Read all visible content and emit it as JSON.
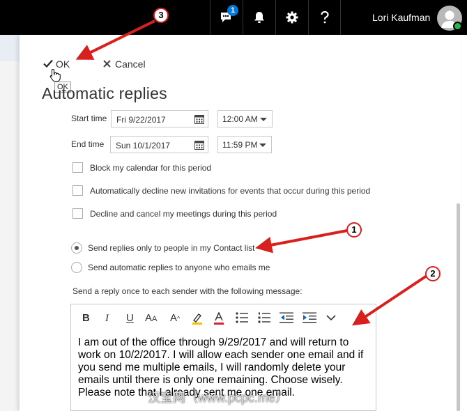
{
  "topbar": {
    "user_name": "Lori Kaufman",
    "chat_badge": "1",
    "icons": [
      "chat-icon",
      "bell-icon",
      "gear-icon",
      "help-icon",
      "avatar-icon"
    ],
    "background_color": "#000000"
  },
  "commands": {
    "ok_label": "OK",
    "cancel_label": "Cancel",
    "tooltip": "OK"
  },
  "page_title": "Automatic replies",
  "schedule": {
    "start_label": "Start time",
    "start_date": "Fri 9/22/2017",
    "start_time": "12:00 AM",
    "end_label": "End time",
    "end_date": "Sun 10/1/2017",
    "end_time": "11:59 PM"
  },
  "options": [
    {
      "label": "Block my calendar for this period",
      "checked": false
    },
    {
      "label": "Automatically decline new invitations for events that occur during this period",
      "checked": false
    },
    {
      "label": "Decline and cancel my meetings during this period",
      "checked": false
    }
  ],
  "audience": [
    {
      "label": "Send replies only to people in my Contact list",
      "selected": true
    },
    {
      "label": "Send automatic replies to anyone who emails me",
      "selected": false
    }
  ],
  "message": {
    "label": "Send a reply once to each sender with the following message:",
    "toolbar": {
      "bold": "B",
      "italic": "I",
      "underline": "U",
      "font_size": "A",
      "grow_font": "A"
    },
    "body": "I am out of the office through 9/29/2017 and will return to work on 10/2/2017. I will allow each sender one email and if you send me multiple emails, I will randomly delete your emails until there is only one remaining. Choose wisely. Please note that I already sent me one email."
  },
  "watermark": "汉宝网（www.pcpc.me）",
  "annotations": [
    {
      "number": "1"
    },
    {
      "number": "2"
    },
    {
      "number": "3"
    }
  ],
  "colors": {
    "annotation_red": "#d8201e",
    "status_green": "#2fb54a",
    "badge_blue": "#0078d7"
  }
}
